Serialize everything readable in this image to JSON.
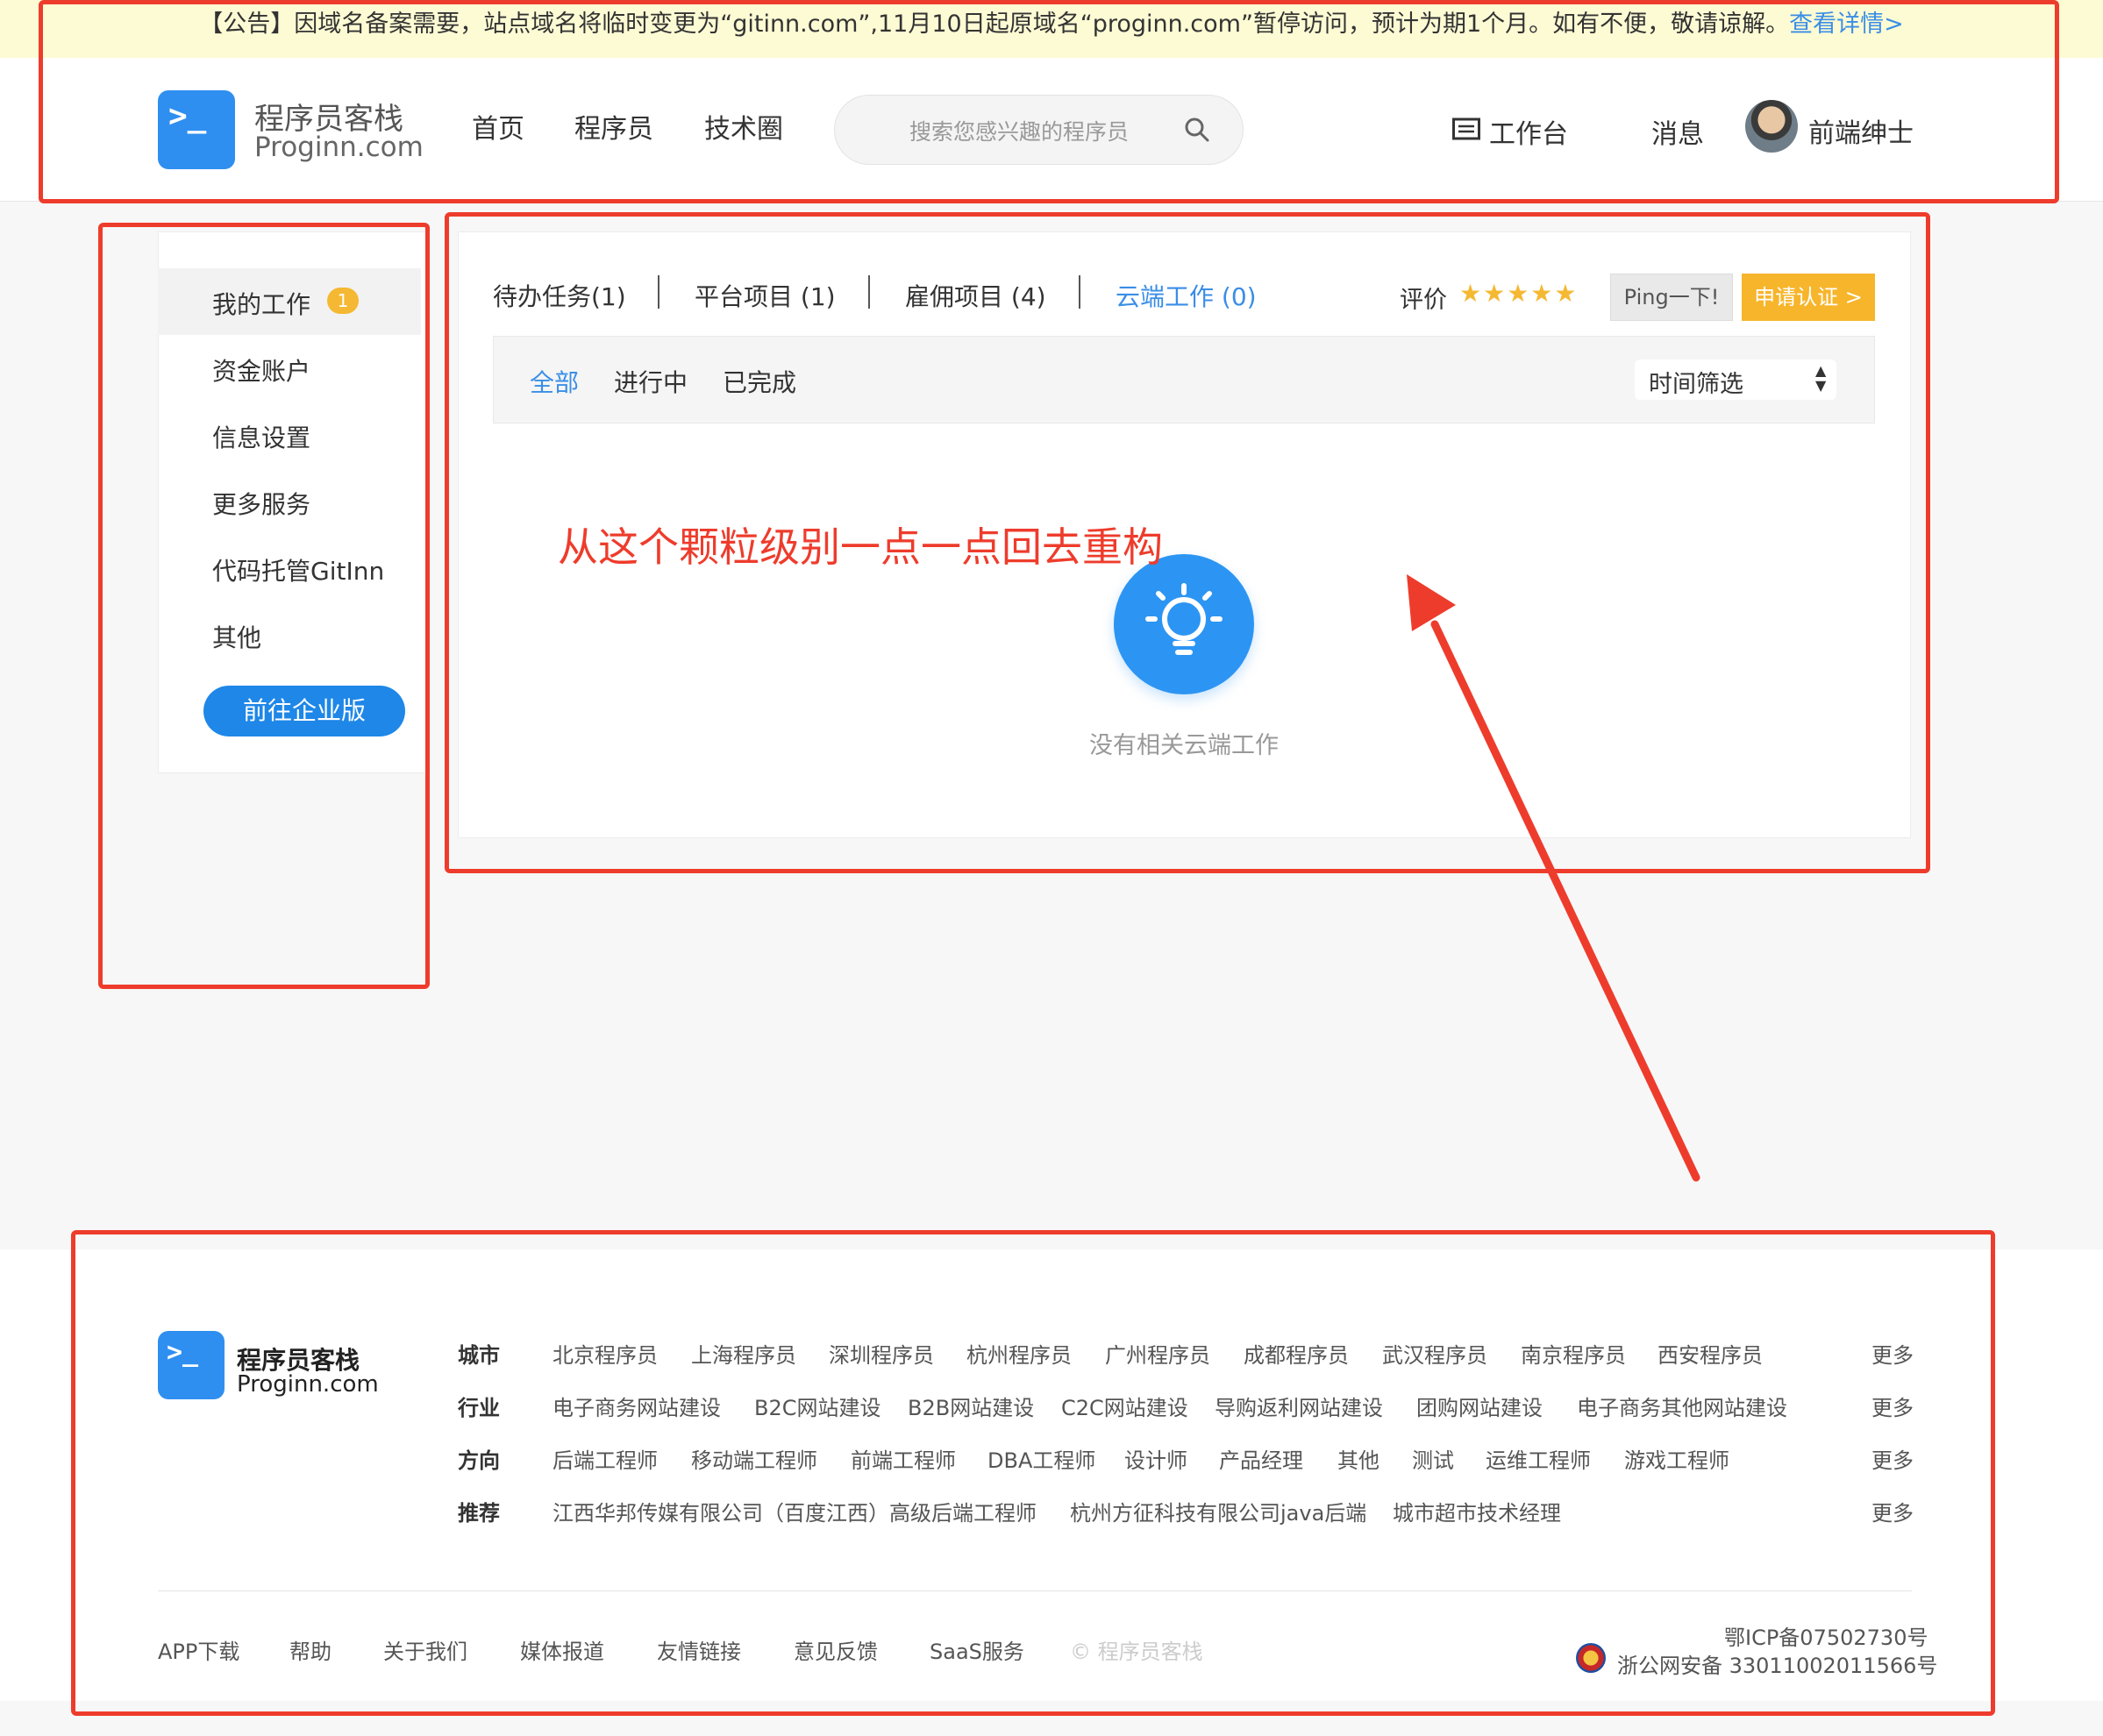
{
  "notice": {
    "text": "【公告】因域名备案需要，站点域名将临时变更为“gitinn.com”,11月10日起原域名“proginn.com”暂停访问，预计为期1个月。如有不便，敬请谅解。",
    "link": "查看详情>"
  },
  "header": {
    "logo_glyph": ">_",
    "brand_cn": "程序员客栈",
    "brand_en": "Proginn.com",
    "nav": [
      "首页",
      "程序员",
      "技术圈"
    ],
    "search_placeholder": "搜索您感兴趣的程序员",
    "workbench": "工作台",
    "messages": "消息",
    "username": "前端绅士"
  },
  "sidebar": {
    "items": [
      {
        "label": "我的工作",
        "badge": "1"
      },
      {
        "label": "资金账户"
      },
      {
        "label": "信息设置"
      },
      {
        "label": "更多服务"
      },
      {
        "label": "代码托管GitInn"
      },
      {
        "label": "其他"
      }
    ],
    "enterprise_button": "前往企业版"
  },
  "main": {
    "tabs": [
      "待办任务(1)",
      "平台项目 (1)",
      "雇佣项目 (4)",
      "云端工作 (0)"
    ],
    "active_tab": 3,
    "rating_label": "评价",
    "stars": "★★★★★",
    "ping_button": "Ping一下!",
    "cert_button": "申请认证 >",
    "filters": [
      "全部",
      "进行中",
      "已完成"
    ],
    "time_filter": "时间筛选",
    "empty_text": "没有相关云端工作"
  },
  "annotation": {
    "text": "从这个颗粒级别一点一点回去重构",
    "color": "#ee3c2c"
  },
  "footer": {
    "logo_glyph": ">_",
    "brand_cn": "程序员客栈",
    "brand_en": "Proginn.com",
    "rows": [
      {
        "label": "城市",
        "links": [
          "北京程序员",
          "上海程序员",
          "深圳程序员",
          "杭州程序员",
          "广州程序员",
          "成都程序员",
          "武汉程序员",
          "南京程序员",
          "西安程序员"
        ],
        "more": "更多"
      },
      {
        "label": "行业",
        "links": [
          "电子商务网站建设",
          "B2C网站建设",
          "B2B网站建设",
          "C2C网站建设",
          "导购返利网站建设",
          "团购网站建设",
          "电子商务其他网站建设"
        ],
        "more": "更多"
      },
      {
        "label": "方向",
        "links": [
          "后端工程师",
          "移动端工程师",
          "前端工程师",
          "DBA工程师",
          "设计师",
          "产品经理",
          "其他",
          "测试",
          "运维工程师",
          "游戏工程师"
        ],
        "more": "更多"
      },
      {
        "label": "推荐",
        "links": [
          "江西华邦传媒有限公司（百度江西）高级后端工程师",
          "杭州方征科技有限公司java后端",
          "城市超市技术经理"
        ],
        "more": "更多"
      }
    ],
    "bottom_links": [
      "APP下载",
      "帮助",
      "关于我们",
      "媒体报道",
      "友情链接",
      "意见反馈",
      "SaaS服务"
    ],
    "copyright": "© 程序员客栈",
    "icp": "鄂ICP备07502730号",
    "police": "浙公网安备 33011002011566号"
  },
  "colors": {
    "accent": "#3a8ee6",
    "brand_blue": "#2f8ff0",
    "star": "#f5b832",
    "cert": "#f7b52b",
    "annotation": "#ee3c2c"
  }
}
